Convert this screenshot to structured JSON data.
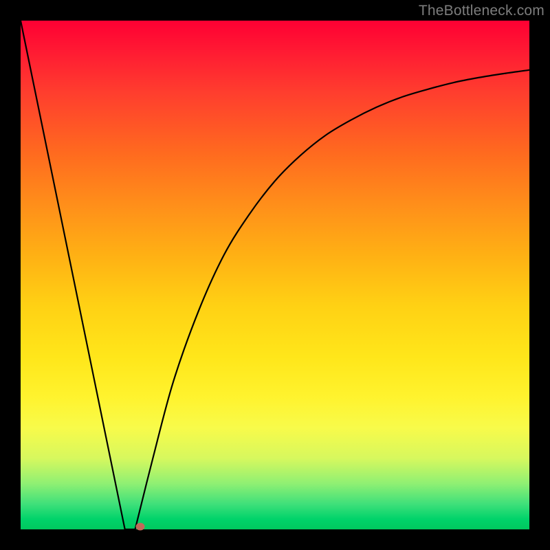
{
  "watermark": "TheBottleneck.com",
  "chart_data": {
    "type": "line",
    "title": "",
    "xlabel": "",
    "ylabel": "",
    "xlim": [
      0,
      1
    ],
    "ylim": [
      0,
      1
    ],
    "gradient_stops": [
      {
        "pos": 0.0,
        "color": "#ff0033"
      },
      {
        "pos": 0.5,
        "color": "#ffc814"
      },
      {
        "pos": 0.8,
        "color": "#f8fb4a"
      },
      {
        "pos": 1.0,
        "color": "#00c85e"
      }
    ],
    "curve_description": "V-shaped bottleneck curve: steep linear descent from top-left to a minimum near x≈0.22, then a concave rise toward the upper right asymptote.",
    "minimum": {
      "x": 0.22,
      "y": 0.0
    },
    "left_branch": [
      {
        "x": 0.0,
        "y": 1.0
      },
      {
        "x": 0.205,
        "y": 0.0
      }
    ],
    "right_branch": [
      {
        "x": 0.225,
        "y": 0.0
      },
      {
        "x": 0.26,
        "y": 0.14
      },
      {
        "x": 0.3,
        "y": 0.29
      },
      {
        "x": 0.35,
        "y": 0.43
      },
      {
        "x": 0.4,
        "y": 0.54
      },
      {
        "x": 0.45,
        "y": 0.62
      },
      {
        "x": 0.5,
        "y": 0.685
      },
      {
        "x": 0.55,
        "y": 0.735
      },
      {
        "x": 0.6,
        "y": 0.775
      },
      {
        "x": 0.65,
        "y": 0.805
      },
      {
        "x": 0.7,
        "y": 0.83
      },
      {
        "x": 0.75,
        "y": 0.85
      },
      {
        "x": 0.8,
        "y": 0.865
      },
      {
        "x": 0.85,
        "y": 0.878
      },
      {
        "x": 0.9,
        "y": 0.888
      },
      {
        "x": 0.95,
        "y": 0.896
      },
      {
        "x": 1.0,
        "y": 0.903
      }
    ],
    "marker": {
      "x": 0.235,
      "y": 0.005,
      "color": "#c06a5a"
    }
  }
}
